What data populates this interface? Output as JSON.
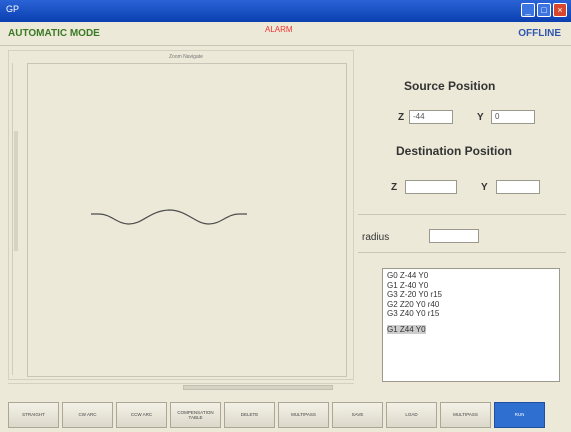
{
  "window": {
    "title": "GP"
  },
  "header": {
    "mode": "AUTOMATIC MODE",
    "alarm": "ALARM",
    "status": "OFFLINE"
  },
  "plot": {
    "caption": "Zoom Navigate"
  },
  "source_position": {
    "title": "Source Position",
    "z_label": "Z",
    "z_value": "-44",
    "y_label": "Y",
    "y_value": "0"
  },
  "destination_position": {
    "title": "Destination Position",
    "z_label": "Z",
    "z_value": "",
    "y_label": "Y",
    "y_value": ""
  },
  "radius": {
    "label": "radius",
    "value": ""
  },
  "gcode_lines": [
    "G0 Z-44 Y0",
    "G1 Z-40 Y0",
    "G3 Z-20 Y0 r15",
    "G2 Z20 Y0 r40",
    "G3 Z40 Y0 r15",
    "G1 Z44 Y0"
  ],
  "toolbar": [
    "STRAIGHT",
    "CW ARC",
    "CCW ARC",
    "COMPENSATION TABLE",
    "DELETE",
    "MULTIPASS",
    "SAVE",
    "LOAD",
    "MULTIPASS",
    "RUN"
  ]
}
